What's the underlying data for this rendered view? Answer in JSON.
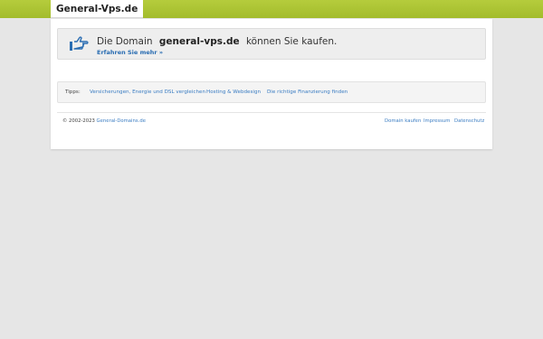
{
  "header": {
    "site_name": "General-Vps.de",
    "accent_color": "#a8c132"
  },
  "offer": {
    "icon": "pointing-hand-icon",
    "prefix": "Die Domain",
    "domain": "general-vps.de",
    "suffix": "können Sie kaufen.",
    "more_link": "Erfahren Sie mehr »"
  },
  "tips": {
    "label": "Tipps:",
    "links": [
      "Versicherungen, Energie und DSL vergleichen",
      "Hosting & Webdesign",
      "Die richtige Finanzierung finden"
    ]
  },
  "footer": {
    "copyright": "© 2002-2023",
    "copyright_link": "General-Domains.de",
    "links": [
      "Domain kaufen",
      "Impressum",
      "Datenschutz"
    ]
  }
}
